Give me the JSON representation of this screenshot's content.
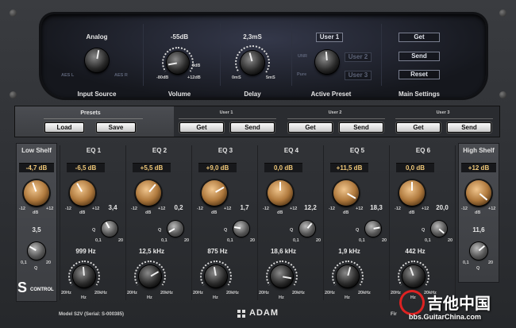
{
  "top": {
    "input_source": {
      "value": "Analog",
      "label": "Input Source",
      "left_option": "AES L",
      "right_option": "AES R"
    },
    "volume": {
      "value": "-55dB",
      "label": "Volume",
      "min": "-80dB",
      "mid": "0dB",
      "max": "+12dB"
    },
    "delay": {
      "value": "2,3mS",
      "label": "Delay",
      "min": "0mS",
      "max": "5mS"
    },
    "active_preset": {
      "value": "User 1",
      "label": "Active Preset",
      "opt_unr": "UNR",
      "opt_user2": "User 2",
      "opt_pure": "Pure",
      "opt_user3": "User 3"
    },
    "main_settings": {
      "label": "Main Settings",
      "get": "Get",
      "send": "Send",
      "reset": "Reset"
    }
  },
  "presets_bar": {
    "presets_title": "Presets",
    "load": "Load",
    "save": "Save",
    "user1": "User 1",
    "user2": "User 2",
    "user3": "User 3",
    "get": "Get",
    "send": "Send"
  },
  "low_shelf": {
    "title": "Low Shelf",
    "gain": "-4,7 dB",
    "min": "-12",
    "unit": "dB",
    "max": "+12",
    "q": "3,5",
    "q_min": "0,1",
    "q_label": "Q",
    "q_max": "20"
  },
  "high_shelf": {
    "title": "High Shelf",
    "gain": "+12 dB",
    "min": "-12",
    "unit": "dB",
    "max": "+12",
    "q": "11,6",
    "q_min": "0,1",
    "q_label": "Q",
    "q_max": "20"
  },
  "eq_bands": [
    {
      "title": "EQ 1",
      "gain": "-6,5 dB",
      "q": "3,4",
      "freq": "999 Hz"
    },
    {
      "title": "EQ 2",
      "gain": "+5,5 dB",
      "q": "0,2",
      "freq": "12,5 kHz"
    },
    {
      "title": "EQ 3",
      "gain": "+9,0 dB",
      "q": "1,7",
      "freq": "875 Hz"
    },
    {
      "title": "EQ 4",
      "gain": "0,0 dB",
      "q": "12,2",
      "freq": "18,6 kHz"
    },
    {
      "title": "EQ 5",
      "gain": "+11,5 dB",
      "q": "18,3",
      "freq": "1,9 kHz"
    },
    {
      "title": "EQ 6",
      "gain": "0,0 dB",
      "q": "20,0",
      "freq": "442 Hz"
    }
  ],
  "band_labels": {
    "gmin": "-12",
    "gunit": "dB",
    "gmax": "+12",
    "q": "Q",
    "qmin": "0,1",
    "qmax": "20",
    "fmin": "20Hz",
    "funit": "Hz",
    "fmax": "20kHz"
  },
  "footer": {
    "s_logo": "S",
    "control": "CONTROL",
    "model": "Model S2V (Serial: S-000385)",
    "brand": "ADAM",
    "firmware": "Fir",
    "watermark_cn": "吉他中国",
    "watermark_url": "bbs.GuitarChina.com"
  },
  "colors": {
    "accent_value": "#f0c878",
    "knob_copper": "#c8864a",
    "panel": "#3a3c40",
    "display": "#1c1f29"
  }
}
